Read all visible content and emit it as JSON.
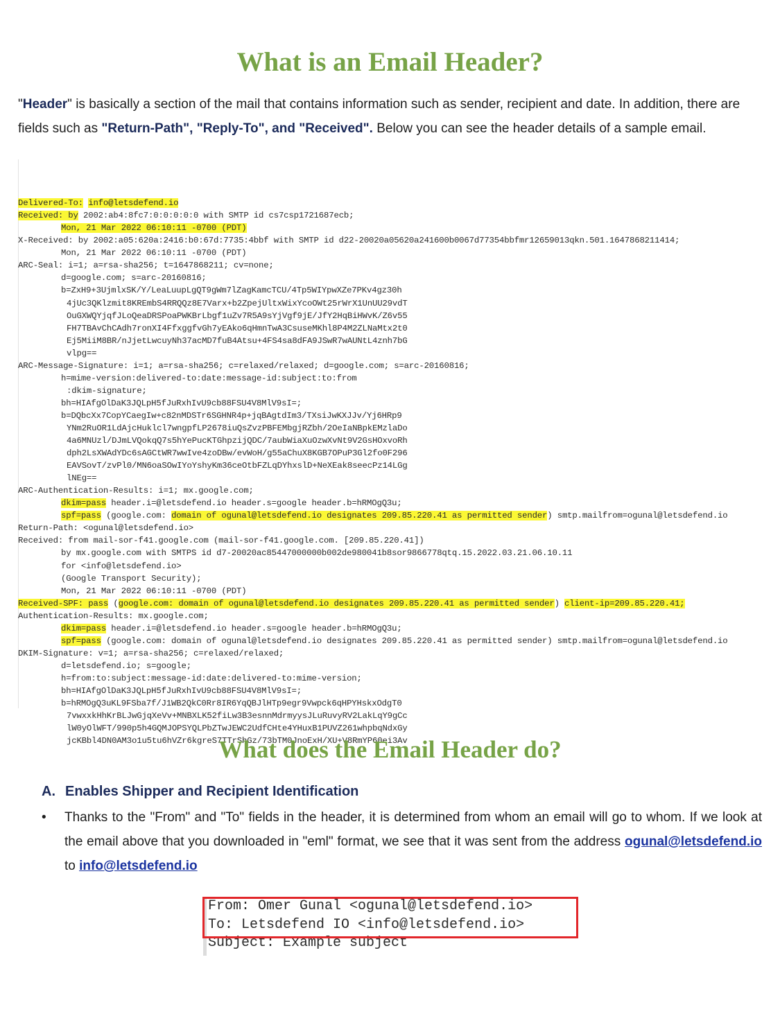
{
  "title_main": "What is an Email Header?",
  "intro": {
    "q1": "\"",
    "header_word": "Header",
    "q2": "\"",
    "text1": " is basically a section of the mail that contains information such as sender, recipient and date. In addition, there are fields such as ",
    "fields": "\"Return-Path\", \"Reply-To\", and \"Received\".",
    "text2": " Below you can see the header details of a sample email."
  },
  "header_lines": [
    {
      "indent": 0,
      "parts": [
        {
          "t": "Delivered-To:",
          "hl": true
        },
        {
          "t": " "
        },
        {
          "t": "info@letsdefend.io",
          "hl": true
        }
      ]
    },
    {
      "indent": 0,
      "parts": [
        {
          "t": "Received: by",
          "hl": true
        },
        {
          "t": " 2002:ab4:8fc7:0:0:0:0:0 with SMTP id cs7csp1721687ecb;"
        }
      ]
    },
    {
      "indent": 1,
      "parts": [
        {
          "t": "Mon, 21 Mar 2022 06:10:11 -0700 (PDT)",
          "hl": true
        }
      ]
    },
    {
      "indent": 0,
      "parts": [
        {
          "t": "X-Received: by 2002:a05:620a:2416:b0:67d:7735:4bbf with SMTP id d22-20020a05620a241600b0067d77354bbfmr12659013qkn.501.1647868211414;"
        }
      ]
    },
    {
      "indent": 1,
      "parts": [
        {
          "t": "Mon, 21 Mar 2022 06:10:11 -0700 (PDT)"
        }
      ]
    },
    {
      "indent": 0,
      "parts": [
        {
          "t": "ARC-Seal: i=1; a=rsa-sha256; t=1647868211; cv=none;"
        }
      ]
    },
    {
      "indent": 1,
      "parts": [
        {
          "t": "d=google.com; s=arc-20160816;"
        }
      ]
    },
    {
      "indent": 1,
      "parts": [
        {
          "t": "b=ZxH9+3UjmlxSK/Y/LeaLuupLgQT9gWm7lZagKamcTCU/4Tp5WIYpwXZe7PKv4gz30h"
        }
      ]
    },
    {
      "indent": 2,
      "parts": [
        {
          "t": "4jUc3QKlzmit8KREmbS4RRQQz8E7Varx+b2ZpejUltxWixYcoOWt25rWrX1UnUU29vdT"
        }
      ]
    },
    {
      "indent": 2,
      "parts": [
        {
          "t": "OuGXWQYjqfJLoQeaDRSPoaPWKBrLbgf1uZv7R5A9sYjVgf9jE/JfY2HqBiHWvK/Z6v55"
        }
      ]
    },
    {
      "indent": 2,
      "parts": [
        {
          "t": "FH7TBAvChCAdh7ronXI4FfxggfvGh7yEAko6qHmnTwA3CsuseMKhl8P4M2ZLNaMtx2t0"
        }
      ]
    },
    {
      "indent": 2,
      "parts": [
        {
          "t": "Ej5MiiM8BR/nJjetLwcuyNh37acMD7fuB4Atsu+4FS4sa8dFA9JSwR7wAUNtL4znh7bG"
        }
      ]
    },
    {
      "indent": 2,
      "parts": [
        {
          "t": "vlpg=="
        }
      ]
    },
    {
      "indent": 0,
      "parts": [
        {
          "t": "ARC-Message-Signature: i=1; a=rsa-sha256; c=relaxed/relaxed; d=google.com; s=arc-20160816;"
        }
      ]
    },
    {
      "indent": 1,
      "parts": [
        {
          "t": "h=mime-version:delivered-to:date:message-id:subject:to:from"
        }
      ]
    },
    {
      "indent": 2,
      "parts": [
        {
          "t": ":dkim-signature;"
        }
      ]
    },
    {
      "indent": 1,
      "parts": [
        {
          "t": "bh=HIAfgOlDaK3JQLpH5fJuRxhIvU9cb88FSU4V8MlV9sI=;"
        }
      ]
    },
    {
      "indent": 1,
      "parts": [
        {
          "t": "b=DQbcXx7CopYCaegIw+c82nMDSTr6SGHNR4p+jqBAgtdIm3/TXsiJwKXJJv/Yj6HRp9"
        }
      ]
    },
    {
      "indent": 2,
      "parts": [
        {
          "t": "YNm2RuOR1LdAjcHuklcl7wngpfLP2678iuQsZvzPBFEMbgjRZbh/2OeIaNBpkEMzlaDo"
        }
      ]
    },
    {
      "indent": 2,
      "parts": [
        {
          "t": "4a6MNUzl/DJmLVQokqQ7s5hYePucKTGhpzijQDC/7aubWiaXuOzwXvNt9V2GsHOxvoRh"
        }
      ]
    },
    {
      "indent": 2,
      "parts": [
        {
          "t": "dph2LsXWAdYDc6sAGCtWR7wwIve4zoDBw/evWoH/g55aChuX8KGB7OPuP3Gl2fo0F296"
        }
      ]
    },
    {
      "indent": 2,
      "parts": [
        {
          "t": "EAVSovT/zvPl0/MN6oaSOwIYoYshyKm36ceOtbFZLqDYhxslD+NeXEak8seecPz14LGg"
        }
      ]
    },
    {
      "indent": 2,
      "parts": [
        {
          "t": "lNEg=="
        }
      ]
    },
    {
      "indent": 0,
      "parts": [
        {
          "t": "ARC-Authentication-Results: i=1; mx.google.com;"
        }
      ]
    },
    {
      "indent": 1,
      "parts": [
        {
          "t": "dkim=pass",
          "hl": true
        },
        {
          "t": " header.i=@letsdefend.io header.s=google header.b=hRMOgQ3u;"
        }
      ]
    },
    {
      "indent": 1,
      "parts": [
        {
          "t": "spf=pass",
          "hl": true
        },
        {
          "t": " (google.com: "
        },
        {
          "t": "domain of ogunal@letsdefend.io designates 209.85.220.41 as permitted sender",
          "hl": true
        },
        {
          "t": ") smtp.mailfrom=ogunal@letsdefend.io"
        }
      ]
    },
    {
      "indent": 0,
      "parts": [
        {
          "t": "Return-Path: <ogunal@letsdefend.io>"
        }
      ]
    },
    {
      "indent": 0,
      "parts": [
        {
          "t": "Received: from mail-sor-f41.google.com (mail-sor-f41.google.com. [209.85.220.41])"
        }
      ]
    },
    {
      "indent": 1,
      "parts": [
        {
          "t": "by mx.google.com with SMTPS id d7-20020ac85447000000b002de980041b8sor9866778qtq.15.2022.03.21.06.10.11"
        }
      ]
    },
    {
      "indent": 1,
      "parts": [
        {
          "t": "for <info@letsdefend.io>"
        }
      ]
    },
    {
      "indent": 1,
      "parts": [
        {
          "t": "(Google Transport Security);"
        }
      ]
    },
    {
      "indent": 1,
      "parts": [
        {
          "t": "Mon, 21 Mar 2022 06:10:11 -0700 (PDT)"
        }
      ]
    },
    {
      "indent": 0,
      "parts": [
        {
          "t": "Received-SPF: pass",
          "hl": true
        },
        {
          "t": " ("
        },
        {
          "t": "google.com: domain of ogunal@letsdefend.io designates 209.85.220.41 as permitted sender",
          "hl": true
        },
        {
          "t": ") "
        },
        {
          "t": "client-ip=209.85.220.41;",
          "hl": true
        }
      ]
    },
    {
      "indent": 0,
      "parts": [
        {
          "t": "Authentication-Results: mx.google.com;"
        }
      ]
    },
    {
      "indent": 1,
      "parts": [
        {
          "t": "dkim=pass",
          "hl": true
        },
        {
          "t": " header.i=@letsdefend.io header.s=google header.b=hRMOgQ3u;"
        }
      ]
    },
    {
      "indent": 1,
      "parts": [
        {
          "t": "spf=pass",
          "hl": true
        },
        {
          "t": " (google.com: domain of ogunal@letsdefend.io designates 209.85.220.41 as permitted sender) smtp.mailfrom=ogunal@letsdefend.io"
        }
      ]
    },
    {
      "indent": 0,
      "parts": [
        {
          "t": "DKIM-Signature: v=1; a=rsa-sha256; c=relaxed/relaxed;"
        }
      ]
    },
    {
      "indent": 1,
      "parts": [
        {
          "t": "d=letsdefend.io; s=google;"
        }
      ]
    },
    {
      "indent": 1,
      "parts": [
        {
          "t": "h=from:to:subject:message-id:date:delivered-to:mime-version;"
        }
      ]
    },
    {
      "indent": 1,
      "parts": [
        {
          "t": "bh=HIAfgOlDaK3JQLpH5fJuRxhIvU9cb88FSU4V8MlV9sI=;"
        }
      ]
    },
    {
      "indent": 1,
      "parts": [
        {
          "t": "b=hRMOgQ3uKL9FSba7f/J1WB2QkC0Rr8IR6YqQBJlHTp9egr9Vwpck6qHPYHskxOdgT0"
        }
      ]
    },
    {
      "indent": 2,
      "parts": [
        {
          "t": "7vwxxkHhKrBLJwGjqXeVv+MNBXLK52fiLw3B3esnnMdrmyysJLuRuvyRV2LakLqY9gCc"
        }
      ]
    },
    {
      "indent": 2,
      "parts": [
        {
          "t": "lW0yOlWFT/990p5h4GQMJOPSYQLPbZTwJEWC2UdfCHte4YHuxB1PUVZ261whpbqNdxGy"
        }
      ]
    },
    {
      "indent": 2,
      "parts": [
        {
          "t": "jcKBbl4DN0AM3o1u5tu6hVZr6kgreS7TTrShGz/73bTM0JnoExH/XU+V8RmYP60ei3Av"
        }
      ]
    }
  ],
  "title_second": "What does the Email Header do?",
  "section_a": {
    "letter": "A.",
    "heading": "Enables Shipper and Recipient Identification",
    "bullet_symbol": "•",
    "text": "Thanks to the \"From\" and \"To\" fields in the header, it is determined from whom an email will go to whom. If we look at the email above that you downloaded in \"eml\" format, we see that it was sent from the address ",
    "link_from": "ogunal@letsdefend.io",
    "to_word": " to ",
    "link_to": "info@letsdefend.io"
  },
  "sample_email": {
    "from_line": "From: Omer Gunal <ogunal@letsdefend.io>",
    "to_line": "To: Letsdefend IO <info@letsdefend.io>",
    "subject_line": "Subject: Example subject",
    "box_color": "#e2262a"
  },
  "colors": {
    "title_green": "#77a347",
    "highlight_yellow": "#fbf734",
    "navy_bold": "#1b2a5a",
    "link_blue": "#1a33a0"
  }
}
